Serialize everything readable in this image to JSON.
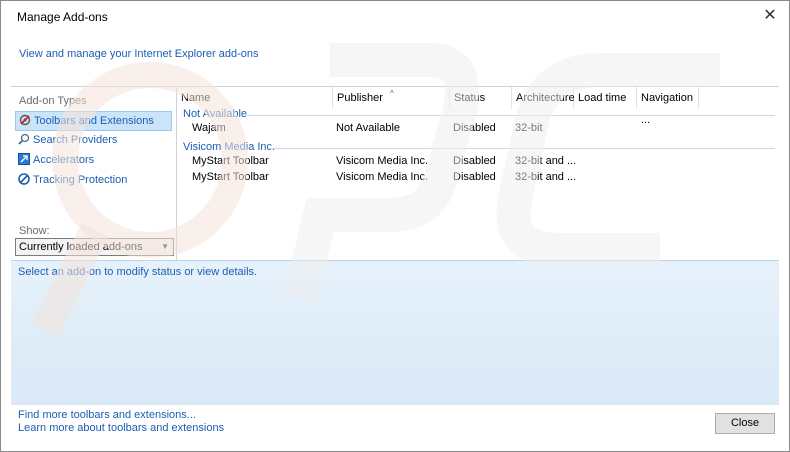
{
  "window": {
    "title": "Manage Add-ons",
    "subtitle": "View and manage your Internet Explorer add-ons"
  },
  "sidebar": {
    "heading": "Add-on Types",
    "items": [
      {
        "label": "Toolbars and Extensions",
        "icon": "gear-blocked-icon",
        "selected": true
      },
      {
        "label": "Search Providers",
        "icon": "search-icon",
        "selected": false
      },
      {
        "label": "Accelerators",
        "icon": "accelerator-icon",
        "selected": false
      },
      {
        "label": "Tracking Protection",
        "icon": "block-icon",
        "selected": false
      }
    ],
    "show_label": "Show:",
    "show_value": "Currently loaded add-ons"
  },
  "list": {
    "columns": [
      "Name",
      "Publisher",
      "Status",
      "Architecture",
      "Load time",
      "Navigation ..."
    ],
    "groups": [
      {
        "name": "Not Available",
        "rows": [
          {
            "name": "Wajam",
            "publisher": "Not Available",
            "status": "Disabled",
            "architecture": "32-bit"
          }
        ]
      },
      {
        "name": "Visicom Media Inc.",
        "rows": [
          {
            "name": "MyStart Toolbar",
            "publisher": "Visicom Media Inc.",
            "status": "Disabled",
            "architecture": "32-bit and ..."
          },
          {
            "name": "MyStart Toolbar",
            "publisher": "Visicom Media Inc.",
            "status": "Disabled",
            "architecture": "32-bit and ..."
          }
        ]
      }
    ]
  },
  "details": {
    "hint": "Select an add-on to modify status or view details."
  },
  "footer": {
    "find_more": "Find more toolbars and extensions...",
    "learn_more": "Learn more about toolbars and extensions",
    "close_label": "Close"
  },
  "colors": {
    "link": "#1a5fb4",
    "selection": "#cce4f7",
    "details_bg": "#e6f1fa"
  }
}
